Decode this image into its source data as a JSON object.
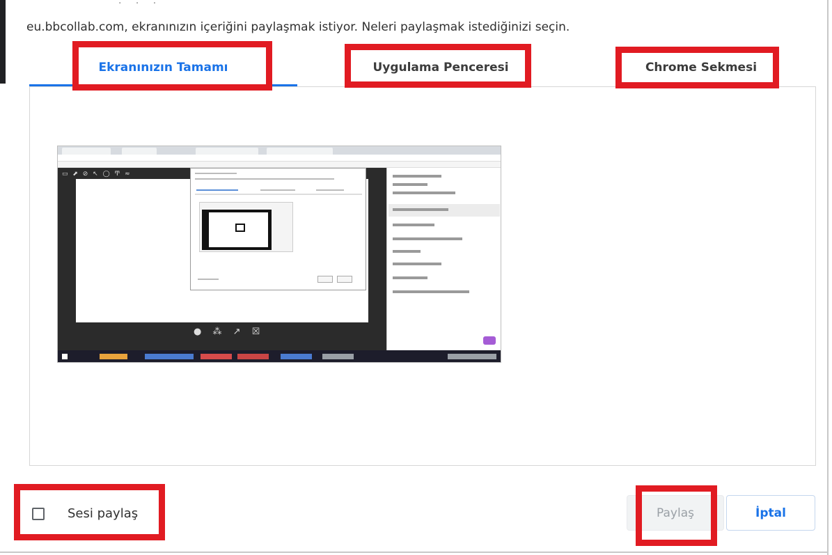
{
  "dialog": {
    "prompt": "eu.bbcollab.com, ekranınızın içeriğini paylaşmak istiyor. Neleri paylaşmak istediğinizi seçin.",
    "tabs": [
      {
        "label": "Ekranınızın Tamamı",
        "active": true
      },
      {
        "label": "Uygulama Penceresi",
        "active": false
      },
      {
        "label": "Chrome Sekmesi",
        "active": false
      }
    ],
    "audio": {
      "label": "Sesi paylaş",
      "checked": false
    },
    "buttons": {
      "share": "Paylaş",
      "cancel": "İptal"
    }
  },
  "colors": {
    "accent": "#1a73e8",
    "highlight": "#e11b22",
    "disabled_text": "#9aa0a6"
  },
  "icons": {
    "checkbox": "checkbox-unchecked-icon"
  }
}
